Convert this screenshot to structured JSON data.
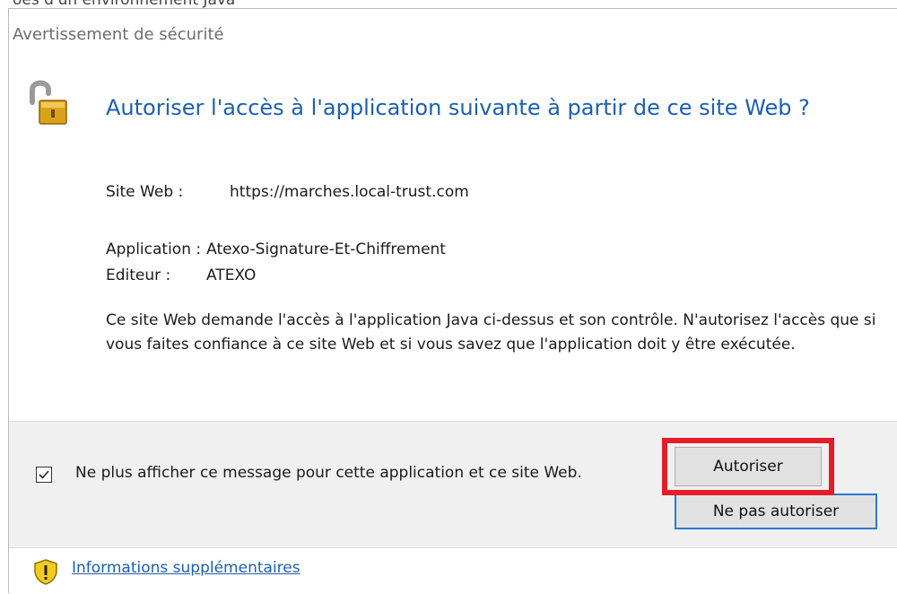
{
  "background_text": "oes d'un environnement Java",
  "dialog": {
    "title": "Avertissement de sécurité",
    "heading": "Autoriser l'accès à l'application suivante à partir de ce site Web ?",
    "website": {
      "label": "Site Web :",
      "value": "https://marches.local-trust.com"
    },
    "application": {
      "label": "Application :",
      "value": "Atexo-Signature-Et-Chiffrement"
    },
    "publisher": {
      "label": "Editeur :",
      "value": "ATEXO"
    },
    "description": "Ce site Web demande l'accès à l'application Java ci-dessus et son contrôle. N'autorisez l'accès que si vous faites confiance à ce site Web et si vous savez que l'application doit y être exécutée.",
    "checkbox": {
      "label": "Ne plus afficher ce message pour cette application et ce site Web.",
      "checked": true
    },
    "buttons": {
      "allow": "Autoriser",
      "deny": "Ne pas autoriser"
    },
    "more_info_link": "Informations supplémentaires"
  },
  "icons": {
    "header": "lock-open-icon",
    "info": "shield-warning-icon",
    "check": "check-icon"
  },
  "colors": {
    "heading": "#1d5fb0",
    "highlight": "#e31d2a",
    "footer_bg": "#f0f0f0",
    "focus_border": "#2b7ad2"
  }
}
